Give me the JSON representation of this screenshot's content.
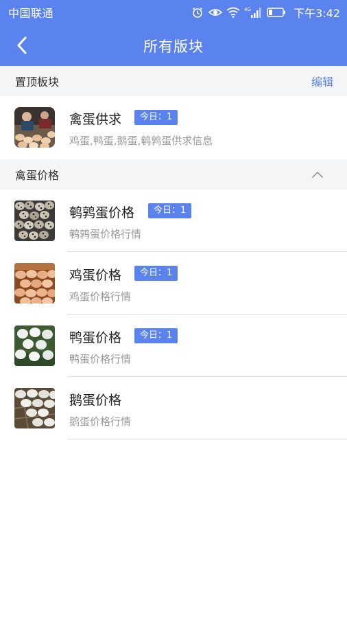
{
  "status_bar": {
    "carrier": "中国联通",
    "network_label": "4G",
    "time": "下午3:42",
    "icons": [
      "alarm-icon",
      "eye-icon",
      "wifi-icon",
      "signal-icon",
      "battery-icon"
    ]
  },
  "header": {
    "title": "所有版块",
    "back_icon": "chevron-left-icon"
  },
  "pinned_section": {
    "title": "置顶板块",
    "action_label": "编辑",
    "items": [
      {
        "name": "禽蛋供求",
        "badge": "今日：1",
        "description": "鸡蛋,鸭蛋,鹅蛋,鹌鹑蛋供求信息",
        "thumb": "poultry-egg-market-photo"
      }
    ]
  },
  "price_section": {
    "title": "禽蛋价格",
    "collapse_icon": "chevron-up-icon",
    "items": [
      {
        "name": "鹌鹑蛋价格",
        "badge": "今日：1",
        "description": "鹌鹑蛋价格行情",
        "thumb": "quail-egg-photo"
      },
      {
        "name": "鸡蛋价格",
        "badge": "今日：1",
        "description": "鸡蛋价格行情",
        "thumb": "chicken-egg-photo"
      },
      {
        "name": "鸭蛋价格",
        "badge": "今日：1",
        "description": "鸭蛋价格行情",
        "thumb": "duck-egg-photo"
      },
      {
        "name": "鹅蛋价格",
        "description": "鹅蛋价格行情",
        "thumb": "goose-egg-photo"
      }
    ]
  },
  "colors": {
    "primary": "#5b83ee",
    "section_bg": "#f4f5f7",
    "title_text": "#222222",
    "sub_text": "#9a9a9a"
  }
}
